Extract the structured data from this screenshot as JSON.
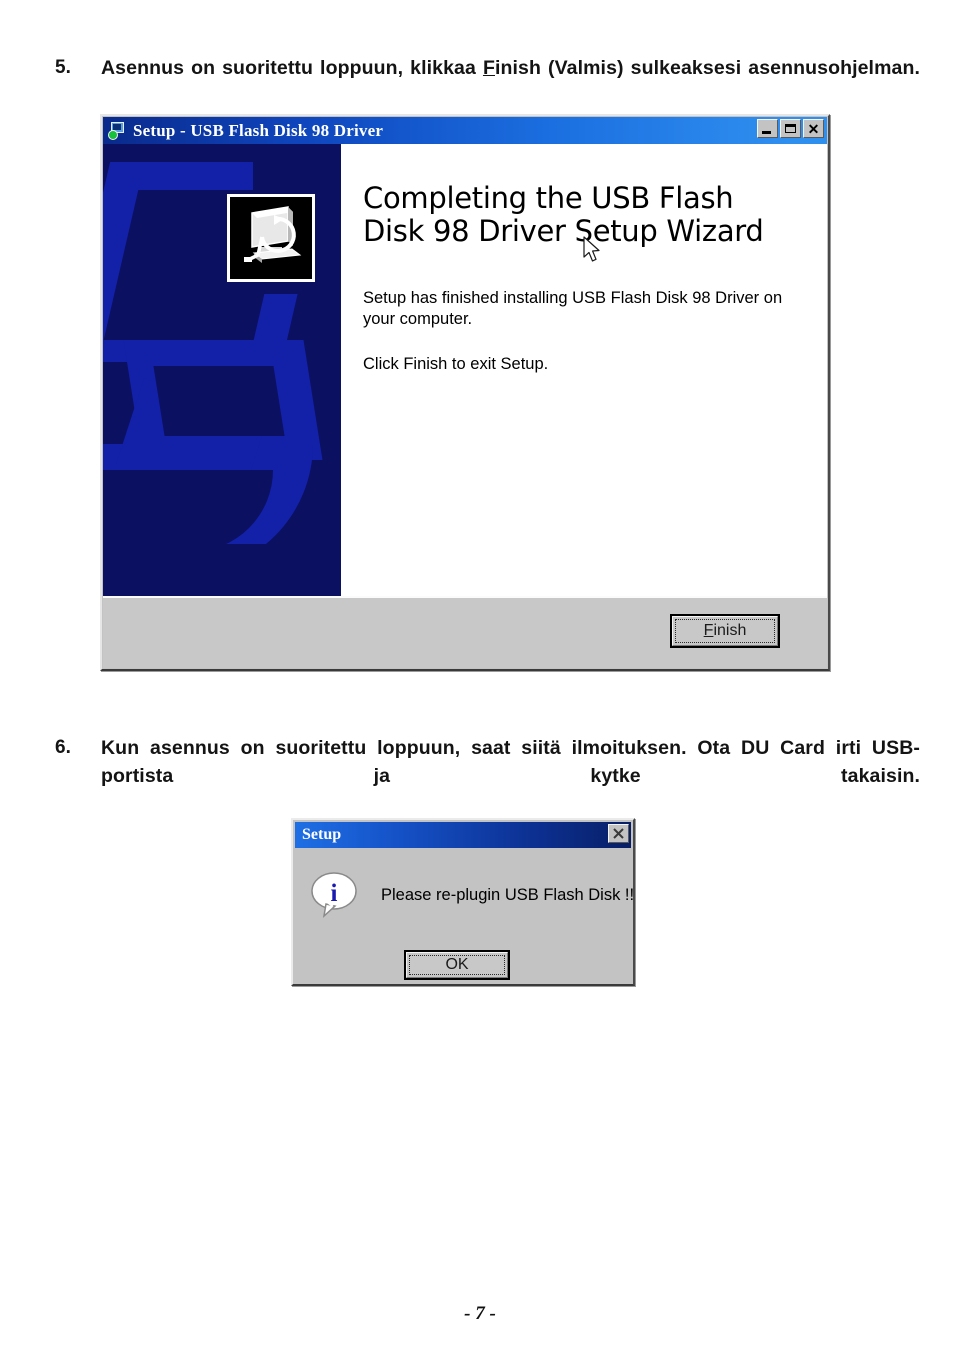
{
  "document": {
    "steps": [
      {
        "number": "5.",
        "text_before": "Asennus on suoritettu loppuun, klikkaa ",
        "emphasis_underline": "F",
        "emphasis_rest": "inish",
        "text_after": " (Valmis) sulkeaksesi asennusohjelman."
      },
      {
        "number": "6.",
        "text": "Kun asennus on suoritettu loppuun, saat siitä ilmoituksen. Ota DU Card irti USB-portista ja kytke takaisin."
      }
    ],
    "page_number": "- 7 -"
  },
  "wizard_window": {
    "title": "Setup - USB Flash Disk 98 Driver",
    "icon": "setup-disk-icon",
    "title_buttons": {
      "minimize": "_",
      "maximize": "□",
      "close": "✕"
    },
    "side_panel": {
      "icon": "computer-install-icon",
      "background_color": "#0b1060",
      "accent_color": "#1320a8"
    },
    "heading": "Completing the USB Flash Disk 98 Driver Setup Wizard",
    "paragraph_1": "Setup has finished installing USB Flash Disk 98 Driver on your computer.",
    "paragraph_2": "Click Finish to exit Setup.",
    "finish_button": {
      "label_underlined": "F",
      "label_rest": "inish"
    },
    "cursor": "mouse-pointer"
  },
  "setup_dialog": {
    "title": "Setup",
    "close_label": "✕",
    "icon": "info-icon",
    "message": "Please re-plugin USB Flash Disk !!",
    "ok_button": "OK",
    "title_accent_color": "#0c2f90"
  }
}
